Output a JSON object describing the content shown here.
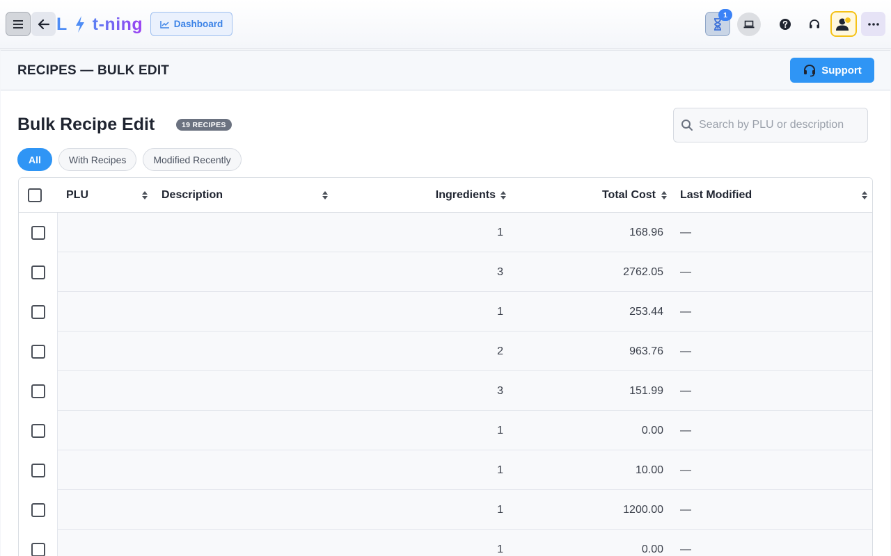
{
  "topbar": {
    "logo_l": "L",
    "logo_rest": "t-ning",
    "dashboard_label": "Dashboard",
    "notification_count": "1"
  },
  "page": {
    "title": "RECIPES — BULK EDIT",
    "support_label": "Support"
  },
  "content": {
    "heading": "Bulk Recipe Edit",
    "count_badge": "19 RECIPES",
    "search_placeholder": "Search by PLU or description",
    "filters": [
      "All",
      "With Recipes",
      "Modified Recently"
    ],
    "active_filter": "All"
  },
  "table": {
    "columns": [
      "PLU",
      "Description",
      "Ingredients",
      "Total Cost",
      "Last Modified"
    ],
    "rows": [
      {
        "plu": "",
        "description": "",
        "ingredients": "1",
        "total_cost": "168.96",
        "last_modified": "—"
      },
      {
        "plu": "",
        "description": "",
        "ingredients": "3",
        "total_cost": "2762.05",
        "last_modified": "—"
      },
      {
        "plu": "",
        "description": "",
        "ingredients": "1",
        "total_cost": "253.44",
        "last_modified": "—"
      },
      {
        "plu": "",
        "description": "",
        "ingredients": "2",
        "total_cost": "963.76",
        "last_modified": "—"
      },
      {
        "plu": "",
        "description": "",
        "ingredients": "3",
        "total_cost": "151.99",
        "last_modified": "—"
      },
      {
        "plu": "",
        "description": "",
        "ingredients": "1",
        "total_cost": "0.00",
        "last_modified": "—"
      },
      {
        "plu": "",
        "description": "",
        "ingredients": "1",
        "total_cost": "10.00",
        "last_modified": "—"
      },
      {
        "plu": "",
        "description": "",
        "ingredients": "1",
        "total_cost": "1200.00",
        "last_modified": "—"
      },
      {
        "plu": "",
        "description": "",
        "ingredients": "1",
        "total_cost": "0.00",
        "last_modified": "—"
      }
    ]
  },
  "colors": {
    "accent": "#2f95f5",
    "logo_gradient_start": "#5b7ff3",
    "logo_gradient_end": "#9b3ff2",
    "badge_gray": "#6b7280",
    "user_ring": "#f5c218"
  }
}
